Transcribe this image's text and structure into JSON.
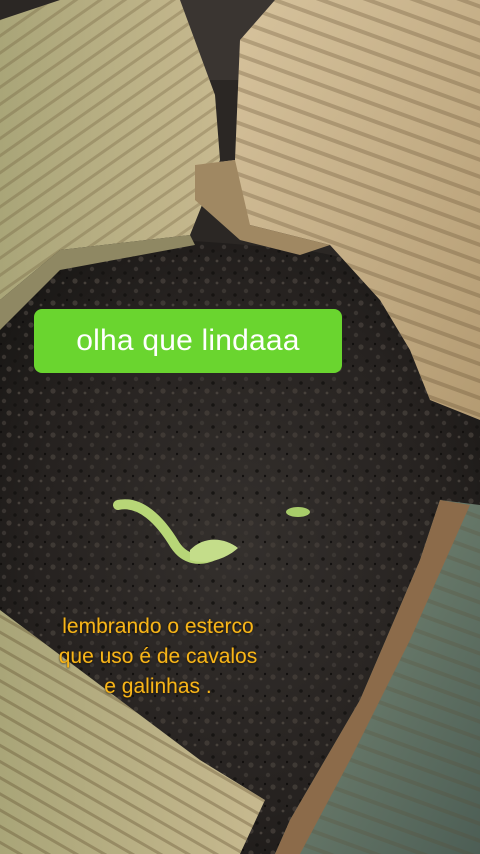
{
  "sticker": {
    "text": "olha que lindaaa",
    "color": "#6ad52f"
  },
  "caption": {
    "lines": [
      "lembrando o esterco",
      "que uso é de cavalos",
      "e galinhas ."
    ],
    "color": "#f7b51a"
  },
  "scene": {
    "subject": "seedling-sprout",
    "colors": {
      "soil": "#2a2624",
      "tile": "#c9b48c",
      "sprout": "#b7d677"
    }
  }
}
